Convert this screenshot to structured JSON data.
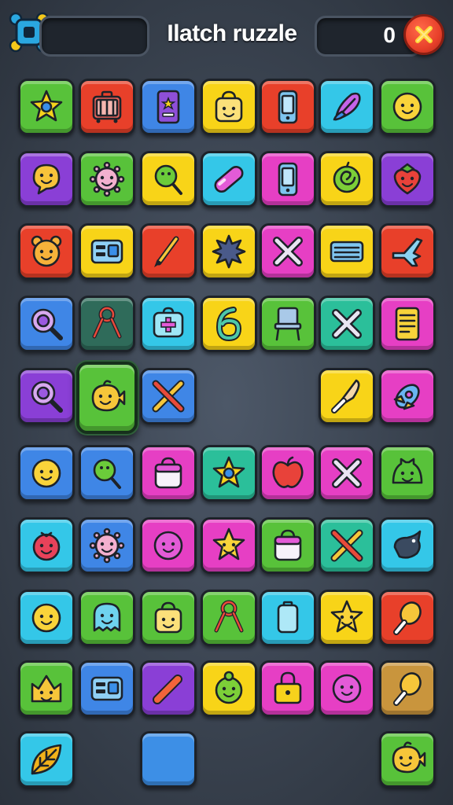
{
  "header": {
    "title": "Ilatch ruzzle",
    "score": "0",
    "logo_icon": "gear-cross-logo-icon",
    "close_icon": "close-icon"
  },
  "colors": {
    "green": "#58c23a",
    "red": "#e8402a",
    "blue": "#3f86e6",
    "yellow": "#f8d418",
    "cyan": "#34c7e8",
    "purple": "#8a3fd6",
    "magenta": "#e63fc4",
    "teal": "#2bbf9a",
    "darkteal": "#2f6b5a",
    "tan": "#c9953d",
    "skyblue": "#3d8fe6"
  },
  "board": {
    "rows": [
      [
        {
          "color": "green",
          "icon": "star-icon"
        },
        {
          "color": "red",
          "icon": "suitcase-icon"
        },
        {
          "color": "blue",
          "icon": "tablet-icon"
        },
        {
          "color": "yellow",
          "icon": "bag-face-icon"
        },
        {
          "color": "red",
          "icon": "phone-icon"
        },
        {
          "color": "cyan",
          "icon": "feather-icon"
        },
        {
          "color": "green",
          "icon": "smiley-icon"
        }
      ],
      [
        {
          "color": "purple",
          "icon": "speech-face-icon"
        },
        {
          "color": "green",
          "icon": "germ-face-icon"
        },
        {
          "color": "yellow",
          "icon": "lollipop-icon"
        },
        {
          "color": "cyan",
          "icon": "capsule-icon"
        },
        {
          "color": "magenta",
          "icon": "phone-icon"
        },
        {
          "color": "yellow",
          "icon": "spiral-ball-icon"
        },
        {
          "color": "purple",
          "icon": "strawberry-icon"
        }
      ],
      [
        {
          "color": "red",
          "icon": "bear-face-icon"
        },
        {
          "color": "yellow",
          "icon": "radio-icon"
        },
        {
          "color": "red",
          "icon": "brush-icon"
        },
        {
          "color": "yellow",
          "icon": "splat-icon"
        },
        {
          "color": "magenta",
          "icon": "cross-icon"
        },
        {
          "color": "yellow",
          "icon": "keyboard-icon"
        },
        {
          "color": "red",
          "icon": "plane-icon"
        }
      ],
      [
        {
          "color": "blue",
          "icon": "magnifier-icon"
        },
        {
          "color": "darkteal",
          "icon": "scissors-icon"
        },
        {
          "color": "cyan",
          "icon": "first-aid-bag-icon"
        },
        {
          "color": "yellow",
          "icon": "number-six-icon"
        },
        {
          "color": "green",
          "icon": "chair-icon"
        },
        {
          "color": "teal",
          "icon": "cross-icon"
        },
        {
          "color": "magenta",
          "icon": "document-icon"
        }
      ],
      [
        {
          "color": "purple",
          "icon": "magnifier-icon"
        },
        {
          "color": "green",
          "icon": "fish-face-icon",
          "selected": true
        },
        {
          "color": "blue",
          "icon": "crossed-tools-icon"
        },
        null,
        null,
        {
          "color": "yellow",
          "icon": "knife-icon"
        },
        {
          "color": "magenta",
          "icon": "rocket-icon"
        }
      ],
      [
        {
          "color": "blue",
          "icon": "smiley-icon"
        },
        {
          "color": "blue",
          "icon": "lollipop-icon"
        },
        {
          "color": "magenta",
          "icon": "bag-icon"
        },
        {
          "color": "teal",
          "icon": "star-icon"
        },
        {
          "color": "magenta",
          "icon": "apple-icon"
        },
        {
          "color": "magenta",
          "icon": "cross-icon"
        },
        {
          "color": "green",
          "icon": "frog-face-icon"
        }
      ],
      [
        {
          "color": "cyan",
          "icon": "berry-face-icon"
        },
        {
          "color": "blue",
          "icon": "germ-face-icon"
        },
        {
          "color": "magenta",
          "icon": "ball-face-icon"
        },
        {
          "color": "magenta",
          "icon": "star-face-icon"
        },
        {
          "color": "green",
          "icon": "bag-icon"
        },
        {
          "color": "teal",
          "icon": "crossed-tools-icon"
        },
        {
          "color": "cyan",
          "icon": "bird-icon"
        }
      ],
      [
        {
          "color": "cyan",
          "icon": "smiley-icon"
        },
        {
          "color": "green",
          "icon": "ghost-face-icon"
        },
        {
          "color": "green",
          "icon": "bag-face-icon"
        },
        {
          "color": "green",
          "icon": "scissors-icon"
        },
        {
          "color": "cyan",
          "icon": "battery-icon"
        },
        {
          "color": "yellow",
          "icon": "star-face-icon"
        },
        {
          "color": "red",
          "icon": "drumstick-icon"
        }
      ],
      [
        {
          "color": "green",
          "icon": "crown-face-icon"
        },
        {
          "color": "blue",
          "icon": "radio-icon"
        },
        {
          "color": "purple",
          "icon": "crayon-icon"
        },
        {
          "color": "yellow",
          "icon": "turtle-face-icon"
        },
        {
          "color": "magenta",
          "icon": "lock-icon"
        },
        {
          "color": "magenta",
          "icon": "ball-face-icon"
        },
        {
          "color": "tan",
          "icon": "drumstick-icon"
        }
      ],
      [
        {
          "color": "cyan",
          "icon": "leaf-icon"
        },
        null,
        {
          "color": "skyblue",
          "icon": "blank-tile-icon"
        },
        null,
        null,
        null,
        {
          "color": "green",
          "icon": "fish-face-icon"
        }
      ]
    ]
  }
}
